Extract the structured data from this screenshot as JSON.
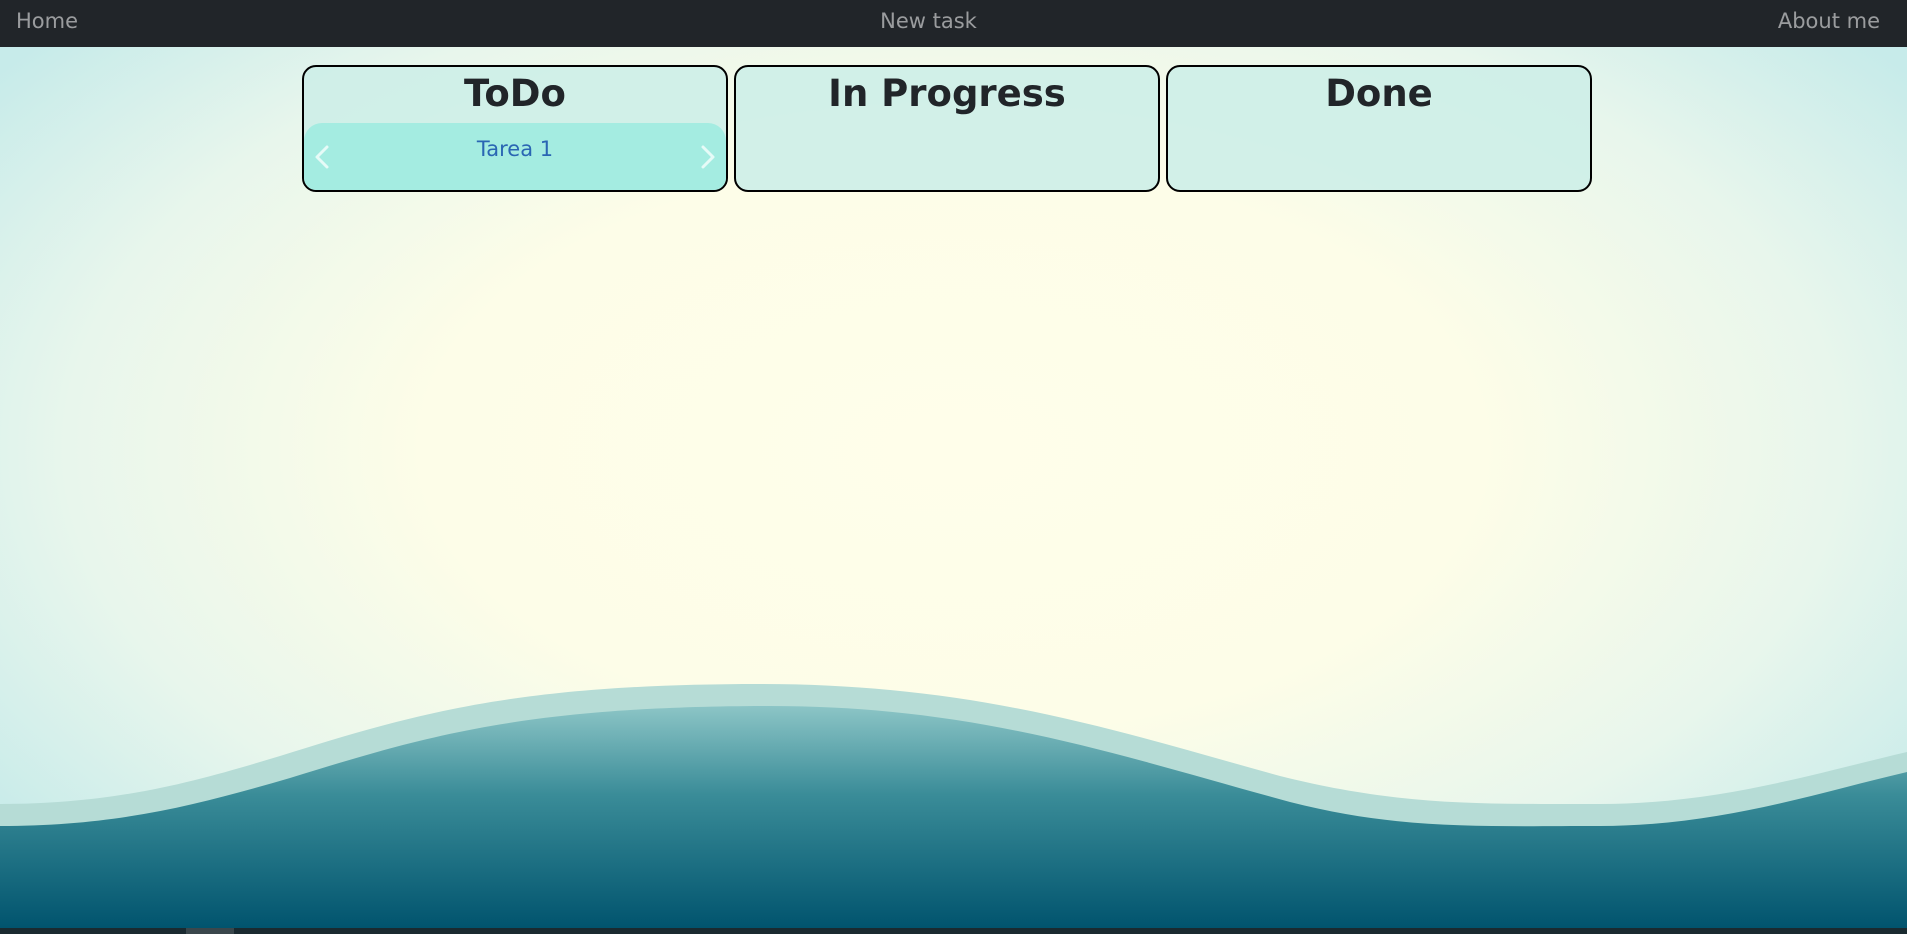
{
  "nav": {
    "home": "Home",
    "new_task": "New task",
    "about": "About me"
  },
  "columns": {
    "todo": {
      "title": "ToDo",
      "tasks": [
        "Tarea 1"
      ]
    },
    "in_progress": {
      "title": "In Progress",
      "tasks": []
    },
    "done": {
      "title": "Done",
      "tasks": []
    }
  },
  "colors": {
    "navbar": "#212529",
    "column_bg": "#cdeee8",
    "task_card_bg": "#a4ece1",
    "task_link": "#2a66b3",
    "wave_dark": "#01546e",
    "wave_light": "#b6dcd6"
  },
  "icons": {
    "carousel_prev": "chevron-left-icon",
    "carousel_next": "chevron-right-icon"
  }
}
